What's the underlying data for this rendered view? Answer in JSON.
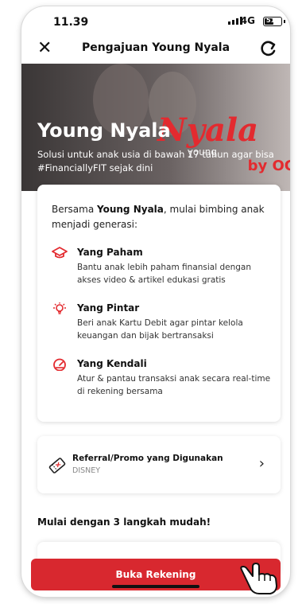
{
  "status": {
    "time": "11.39",
    "network": "4G",
    "battery": "51"
  },
  "nav": {
    "title": "Pengajuan Young Nyala"
  },
  "hero": {
    "title": "Young Nyala",
    "subtitle": "Solusi untuk anak usia di bawah 17 tahun agar bisa #FinanciallyFIT sejak dini",
    "logo_script": "Nyala",
    "logo_by": "by OC",
    "logo_young": "young"
  },
  "intro": {
    "prefix": "Bersama ",
    "brand": "Young Nyala",
    "suffix": ", mulai bimbing anak menjadi generasi:"
  },
  "features": [
    {
      "icon": "graduation-cap-icon",
      "title": "Yang Paham",
      "desc": "Bantu anak lebih paham finansial dengan akses video & artikel edukasi gratis"
    },
    {
      "icon": "lightbulb-icon",
      "title": "Yang Pintar",
      "desc": "Beri anak Kartu Debit agar pintar kelola keuangan dan bijak bertransaksi"
    },
    {
      "icon": "gauge-icon",
      "title": "Yang Kendali",
      "desc": "Atur & pantau transaksi anak secara real-time di rekening bersama"
    }
  ],
  "promo": {
    "title": "Referral/Promo yang Digunakan",
    "code": "DISNEY"
  },
  "steps_heading": "Mulai dengan 3 langkah mudah!",
  "cta": {
    "label": "Buka Rekening"
  },
  "colors": {
    "accent": "#d8282f",
    "feature_icon": "#e32a2f"
  }
}
